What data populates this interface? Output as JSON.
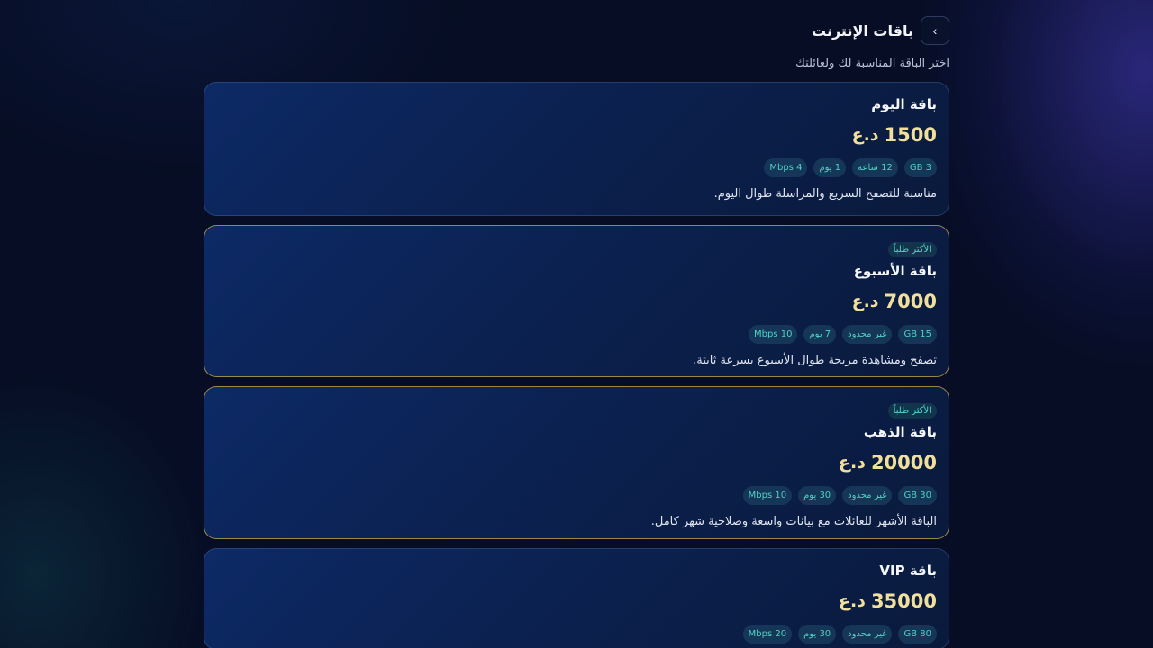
{
  "header": {
    "title": "باقات الإنترنت",
    "back_label": "›"
  },
  "subtitle": "اختر الباقة المناسبة لك ولعائلتك",
  "currency": "د.ع",
  "plans": [
    {
      "name": "باقة اليوم",
      "price": "1500",
      "featured": false,
      "badge": "",
      "chips": [
        "3 GB",
        "12 ساعة",
        "1 يوم",
        "4 Mbps"
      ],
      "description": "مناسبة للتصفح السريع والمراسلة طوال اليوم."
    },
    {
      "name": "باقة الأسبوع",
      "price": "7000",
      "featured": true,
      "badge": "الأكثر طلباً",
      "chips": [
        "15 GB",
        "غير محدود",
        "7 يوم",
        "10 Mbps"
      ],
      "description": "تصفح ومشاهدة مريحة طوال الأسبوع بسرعة ثابتة."
    },
    {
      "name": "باقة الذهب",
      "price": "20000",
      "featured": true,
      "badge": "الأكثر طلباً",
      "chips": [
        "30 GB",
        "غير محدود",
        "30 يوم",
        "10 Mbps"
      ],
      "description": "الباقة الأشهر للعائلات مع بيانات واسعة وصلاحية شهر كامل."
    },
    {
      "name": "باقة VIP",
      "price": "35000",
      "featured": false,
      "badge": "",
      "chips": [
        "80 GB",
        "غير محدود",
        "30 يوم",
        "20 Mbps"
      ],
      "description": ""
    }
  ],
  "colors": {
    "background": "#060d24",
    "card": "#0b2150",
    "price": "#f1df9c",
    "chip_text": "#4fd2c4",
    "featured_border": "#cea846"
  }
}
